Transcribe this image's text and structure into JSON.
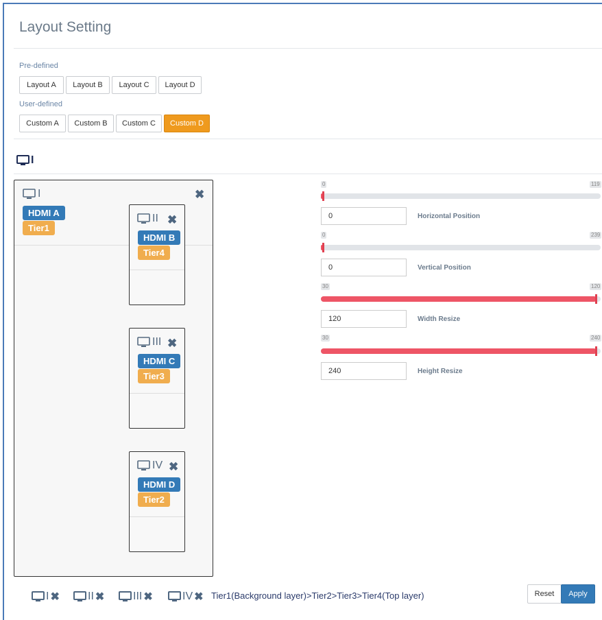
{
  "page": {
    "title": "Layout Setting"
  },
  "predefined": {
    "label": "Pre-defined",
    "buttons": [
      "Layout A",
      "Layout B",
      "Layout C",
      "Layout D"
    ]
  },
  "userdefined": {
    "label": "User-defined",
    "buttons": [
      "Custom A",
      "Custom B",
      "Custom C",
      "Custom D"
    ],
    "active": "Custom D"
  },
  "display_header": {
    "label": "I"
  },
  "windows": [
    {
      "label": "I",
      "source": "HDMI A",
      "tier": "Tier1"
    },
    {
      "label": "II",
      "source": "HDMI B",
      "tier": "Tier4"
    },
    {
      "label": "III",
      "source": "HDMI C",
      "tier": "Tier3"
    },
    {
      "label": "IV",
      "source": "HDMI D",
      "tier": "Tier2"
    }
  ],
  "controls": {
    "horizontal": {
      "min": "0",
      "max": "119",
      "value": "0",
      "label": "Horizontal Position",
      "fraction": 0.0
    },
    "vertical": {
      "min": "0",
      "max": "239",
      "value": "0",
      "label": "Vertical Position",
      "fraction": 0.0
    },
    "width": {
      "min": "30",
      "max": "120",
      "value": "120",
      "label": "Width Resize",
      "fraction": 1.0
    },
    "height": {
      "min": "30",
      "max": "240",
      "value": "240",
      "label": "Height Resize",
      "fraction": 1.0
    }
  },
  "bottom": {
    "window_icons": [
      "I",
      "II",
      "III",
      "IV"
    ],
    "tier_order": "Tier1(Background layer)>Tier2>Tier3>Tier4(Top layer)",
    "reset_label": "Reset",
    "apply_label": "Apply"
  },
  "colors": {
    "accent": "#337ab7",
    "active_button": "#ef9a1e",
    "slider_fill": "#ee5566",
    "tier_badge": "#f0ad4e"
  }
}
